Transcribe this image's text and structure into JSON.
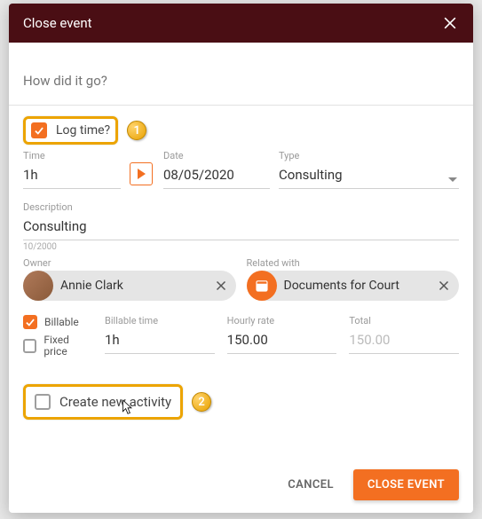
{
  "title": "Close event",
  "howgo_placeholder": "How did it go?",
  "log_time_label": "Log time?",
  "time": {
    "label": "Time",
    "value": "1h"
  },
  "date": {
    "label": "Date",
    "value": "08/05/2020"
  },
  "type": {
    "label": "Type",
    "value": "Consulting"
  },
  "description": {
    "label": "Description",
    "value": "Consulting",
    "counter": "10/2000"
  },
  "owner": {
    "label": "Owner",
    "value": "Annie Clark"
  },
  "related": {
    "label": "Related with",
    "value": "Documents for Court"
  },
  "billable_label": "Billable",
  "fixed_price_label": "Fixed price",
  "billable_time": {
    "label": "Billable time",
    "value": "1h"
  },
  "hourly_rate": {
    "label": "Hourly rate",
    "value": "150.00"
  },
  "total": {
    "label": "Total",
    "value": "150.00"
  },
  "create_new_label": "Create new activity",
  "cancel": "CANCEL",
  "close_event": "CLOSE EVENT",
  "badge1": "1",
  "badge2": "2"
}
